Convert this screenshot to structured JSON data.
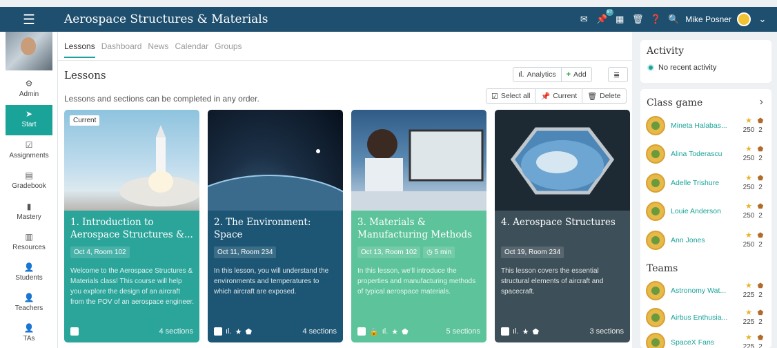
{
  "header": {
    "menu_icon": "hamburger-icon",
    "title": "Aerospace Structures & Materials",
    "notification_count": "97",
    "user_name": "Mike Posner",
    "accent": "#1f4f6e"
  },
  "sidebar": {
    "items": [
      {
        "label": "Admin",
        "icon": "gear-icon"
      },
      {
        "label": "Start",
        "icon": "arrow-icon"
      },
      {
        "label": "Assignments",
        "icon": "assignment-icon"
      },
      {
        "label": "Gradebook",
        "icon": "gradebook-icon"
      },
      {
        "label": "Mastery",
        "icon": "bar-chart-icon"
      },
      {
        "label": "Resources",
        "icon": "resources-icon"
      },
      {
        "label": "Students",
        "icon": "students-icon"
      },
      {
        "label": "Teachers",
        "icon": "teachers-icon"
      },
      {
        "label": "TAs",
        "icon": "tas-icon"
      }
    ]
  },
  "main": {
    "tabs": [
      "Lessons",
      "Dashboard",
      "News",
      "Calendar",
      "Groups"
    ],
    "section_title": "Lessons",
    "subtitle": "Lessons and sections can be completed in any order.",
    "analytics_label": "Analytics",
    "add_label": "Add",
    "select_all_label": "Select all",
    "current_label": "Current",
    "delete_label": "Delete",
    "cards": [
      {
        "badge": "Current",
        "title": "1. Introduction to Aerospace Structures &...",
        "meta1": "Oct 4, Room 102",
        "meta2": "",
        "desc": "Welcome to the Aerospace Structures & Materials class! This course will help you explore the design of an aircraft from the POV of an aerospace engineer.",
        "sections": "4 sections",
        "color": "#2ba59a"
      },
      {
        "badge": "",
        "title": "2. The Environment: Space",
        "meta1": "Oct 11, Room 234",
        "meta2": "",
        "desc": "In this lesson, you will understand the environments and temperatures to which aircraft are exposed.",
        "sections": "4 sections",
        "color": "#1d5674"
      },
      {
        "badge": "",
        "title": "3. Materials & Manufacturing Methods",
        "meta1": "Oct 13, Room 102",
        "meta2": "5 min",
        "desc": "In this lesson, we'll introduce the properties and manufacturing methods of typical aerospace materials.",
        "sections": "5 sections",
        "color": "#5cc39a"
      },
      {
        "badge": "",
        "title": "4. Aerospace Structures",
        "meta1": "Oct 19, Room 234",
        "meta2": "",
        "desc": "This lesson covers the essential structural elements of aircraft and spacecraft.",
        "sections": "3 sections",
        "color": "#3d4f58"
      }
    ]
  },
  "activity": {
    "title": "Activity",
    "status": "No recent activity"
  },
  "class_game": {
    "title": "Class game",
    "players": [
      {
        "name": "Mineta Halabas...",
        "stars": "250",
        "shields": "2"
      },
      {
        "name": "Alina Toderascu",
        "stars": "250",
        "shields": "2"
      },
      {
        "name": "Adelle Trishure",
        "stars": "250",
        "shields": "2"
      },
      {
        "name": "Louie Anderson",
        "stars": "250",
        "shields": "2"
      },
      {
        "name": "Ann Jones",
        "stars": "250",
        "shields": "2"
      }
    ],
    "teams_title": "Teams",
    "teams": [
      {
        "name": "Astronomy Wat...",
        "stars": "225",
        "shields": "2"
      },
      {
        "name": "Airbus Enthusia...",
        "stars": "225",
        "shields": "2"
      },
      {
        "name": "SpaceX Fans",
        "stars": "225",
        "shields": "2"
      }
    ]
  }
}
